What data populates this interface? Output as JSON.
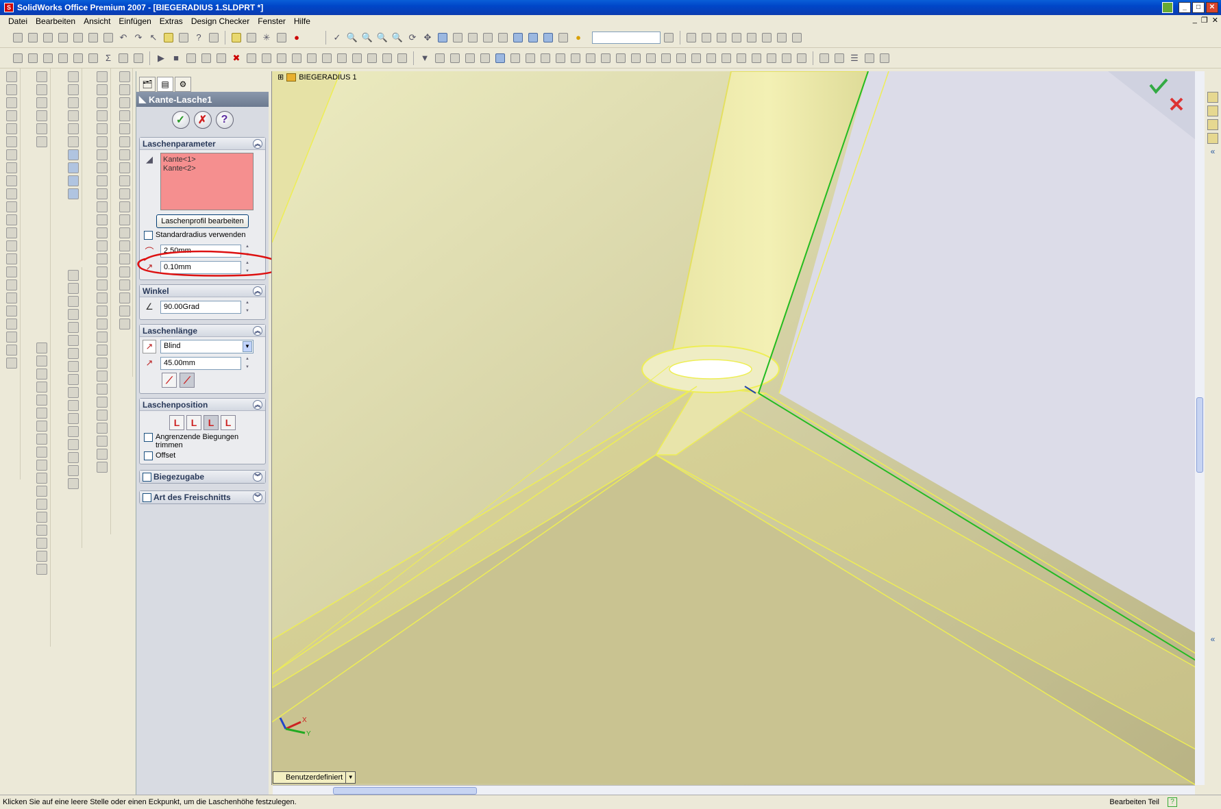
{
  "window": {
    "title": "SolidWorks Office Premium 2007 - [BIEGERADIUS 1.SLDPRT *]"
  },
  "menu": {
    "items": [
      "Datei",
      "Bearbeiten",
      "Ansicht",
      "Einfügen",
      "Extras",
      "Design Checker",
      "Fenster",
      "Hilfe"
    ]
  },
  "panel": {
    "feature_title": "Kante-Lasche1",
    "flange_params": {
      "header": "Laschenparameter",
      "selections": [
        "Kante<1>",
        "Kante<2>"
      ],
      "edit_profile_label": "Laschenprofil bearbeiten",
      "use_default_radius_label": "Standardradius verwenden",
      "bend_radius": "2.50mm",
      "gap": "0.10mm"
    },
    "angle": {
      "header": "Winkel",
      "value": "90.00Grad"
    },
    "length": {
      "header": "Laschenlänge",
      "end_condition": "Blind",
      "value": "45.00mm"
    },
    "position": {
      "header": "Laschenposition",
      "trim_label": "Angrenzende Biegungen trimmen",
      "offset_label": "Offset"
    },
    "bend_allowance": {
      "header": "Biegezugabe"
    },
    "relief": {
      "header": "Art des Freischnitts"
    }
  },
  "tree": {
    "part_name": "BIEGERADIUS 1"
  },
  "view": {
    "orientation_label": "Benutzerdefiniert"
  },
  "status": {
    "message": "Klicken Sie auf eine leere Stelle oder einen Eckpunkt, um die Laschenhöhe festzulegen.",
    "mode": "Bearbeiten Teil",
    "help": "?"
  },
  "colors": {
    "highlight_ring": "#dd1111",
    "model": "#e8e4a0",
    "edge_green": "#22bb22",
    "selection_red": "#f58f8f"
  }
}
